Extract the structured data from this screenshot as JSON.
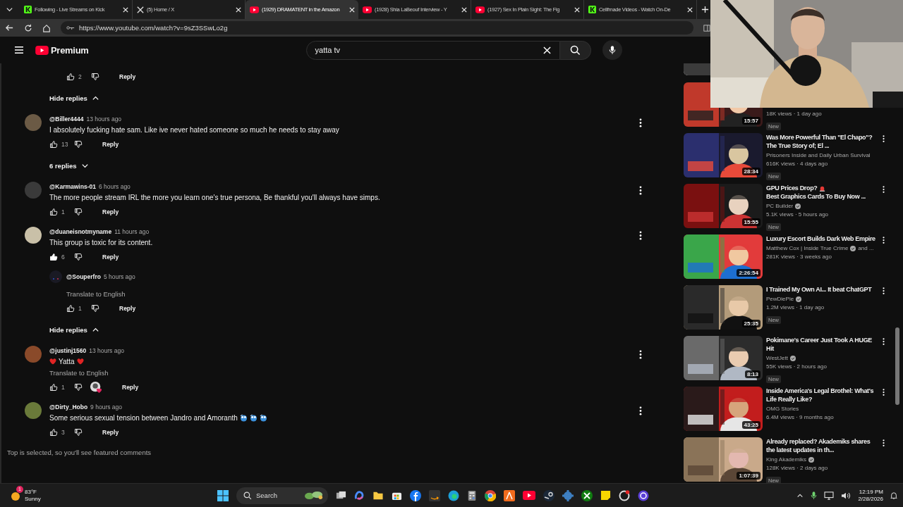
{
  "browser": {
    "tabs": [
      {
        "title": "Following - Live Streams on Kick",
        "kind": "square",
        "selected": false
      },
      {
        "title": "(5) Home / X",
        "kind": "cross",
        "selected": false
      },
      {
        "title": "(1929) DRAMATENT in the Amazon",
        "kind": "play",
        "selected": true
      },
      {
        "title": "(1928) Shia LaBeouf Interview - Y",
        "kind": "play",
        "selected": false
      },
      {
        "title": "(1927) Sex In Plain Sight: The Fig",
        "kind": "play",
        "selected": false
      },
      {
        "title": "Cellfmade Videos - Watch On-De",
        "kind": "square",
        "selected": false
      }
    ],
    "address": "https://www.youtube.com/watch?v=9sZ3SSwLo2g"
  },
  "header": {
    "logo": "Premium",
    "search": "yatta tv"
  },
  "comments": [
    {
      "replies": [
        {
          "likes": "2",
          "liked": false,
          "reply": "Reply"
        }
      ],
      "toggle": {
        "label": "Hide replies",
        "expanded": true
      }
    },
    {
      "author": "@Biller4444",
      "time": "13 hours ago",
      "text": "I absolutely fucking hate sam. Like ive never hated someone so much he needs to stay away",
      "likes": "13",
      "liked": false,
      "reply": "Reply",
      "toggle": {
        "label": "6 replies",
        "expanded": false
      }
    },
    {
      "author": "@Karmawins-01",
      "time": "6 hours ago",
      "text": "The more people stream IRL the more you learn one's true persona, Be thankful you'll always have simps.",
      "likes": "1",
      "liked": false,
      "reply": "Reply"
    },
    {
      "author": "@duaneisnotmyname",
      "time": "11 hours ago",
      "text": "This group is toxic for its content.",
      "likes": "6",
      "liked": true,
      "reply": "Reply",
      "replies": [
        {
          "author": "@Souperfro",
          "time": "5 hours ago",
          "translate": "Translate to English",
          "likes": "1",
          "liked": false,
          "reply": "Reply"
        }
      ],
      "toggle": {
        "label": "Hide replies",
        "expanded": true
      }
    },
    {
      "author": "@justinj1560",
      "time": "13 hours ago",
      "text": "Yatta",
      "hearts": true,
      "translate": "Translate to English",
      "likes": "1",
      "liked": false,
      "creator_heart": true,
      "reply": "Reply"
    },
    {
      "author": "@Dirty_Hobo",
      "time": "9 hours ago",
      "text": "Some serious sexual tension between Jandro and Amoranth",
      "emotes": true,
      "likes": "3",
      "liked": false,
      "reply": "Reply"
    }
  ],
  "footer_note": "Top is selected, so you'll see featured comments",
  "recommendations": [
    {
      "meta": "18K views · 1 day ago",
      "new": "New",
      "duration": "15:57"
    },
    {
      "title": "Was More Powerful Than \"El Chapo\"? The True Story of; El ...",
      "channel": "Prisoners Inside and Daily Urban Survival",
      "verified": false,
      "meta": "616K views · 4 days ago",
      "new": "New",
      "duration": "28:34"
    },
    {
      "title": "GPU Prices Drop?",
      "title_after": "Best Graphics Cards To Buy Now ...",
      "channel": "PC Builder",
      "verified": true,
      "meta": "5.1K views · 5 hours ago",
      "new": "New",
      "duration": "15:55"
    },
    {
      "title": "Luxury Escort Builds Dark Web Empire",
      "channel": "Matthew Cox | Inside True Crime",
      "verified": true,
      "channel_extra": "and ...",
      "meta": "281K views · 3 weeks ago",
      "duration": "2:26:54"
    },
    {
      "title": "I Trained My Own AI... It beat ChatGPT",
      "channel": "PewDiePie",
      "verified": true,
      "meta": "1.2M views · 1 day ago",
      "new": "New",
      "duration": "25:35"
    },
    {
      "title": "Pokimane's Career Just Took A HUGE Hit",
      "channel": "WestJett",
      "verified": true,
      "meta": "55K views · 2 hours ago",
      "new": "New",
      "duration": "8:13"
    },
    {
      "title": "Inside America's Legal Brothel: What's Life Really Like?",
      "channel": "OMG Stories",
      "verified": false,
      "meta": "6.4M views · 9 months ago",
      "duration": "43:25"
    },
    {
      "title": "Already replaced? Akademiks shares the latest updates in th...",
      "channel": "King Akademiks",
      "verified": true,
      "meta": "128K views · 2 days ago",
      "new": "New",
      "duration": "1:07:39"
    }
  ],
  "taskbar": {
    "temp": "83°F",
    "condition": "Sunny",
    "badge": "1",
    "search": "Search",
    "time": "12:19 PM",
    "date": "2/28/2026"
  }
}
